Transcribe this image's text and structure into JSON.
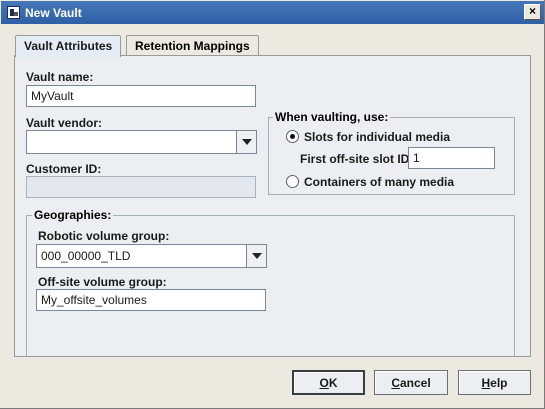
{
  "window": {
    "title": "New Vault",
    "close_glyph": "×"
  },
  "tabs": [
    {
      "label": "Vault Attributes",
      "active": true
    },
    {
      "label": "Retention Mappings",
      "active": false
    }
  ],
  "vault_name": {
    "label": "Vault name:",
    "value": "MyVault"
  },
  "vault_vendor": {
    "label": "Vault vendor:",
    "value": ""
  },
  "customer_id": {
    "label": "Customer ID:",
    "value": ""
  },
  "vaulting": {
    "title": "When vaulting, use:",
    "option_slots": "Slots for individual media",
    "first_slot_label": "First off-site slot ID:",
    "first_slot_value": "1",
    "option_containers": "Containers of many media",
    "selected": "slots"
  },
  "geographies": {
    "title": "Geographies:",
    "robotic_label": "Robotic volume group:",
    "robotic_value": "000_00000_TLD",
    "offsite_label": "Off-site volume group:",
    "offsite_value": "My_offsite_volumes"
  },
  "buttons": {
    "ok_mnemonic": "O",
    "ok_rest": "K",
    "cancel_mnemonic": "C",
    "cancel_rest": "ancel",
    "help_mnemonic": "H",
    "help_rest": "elp"
  }
}
